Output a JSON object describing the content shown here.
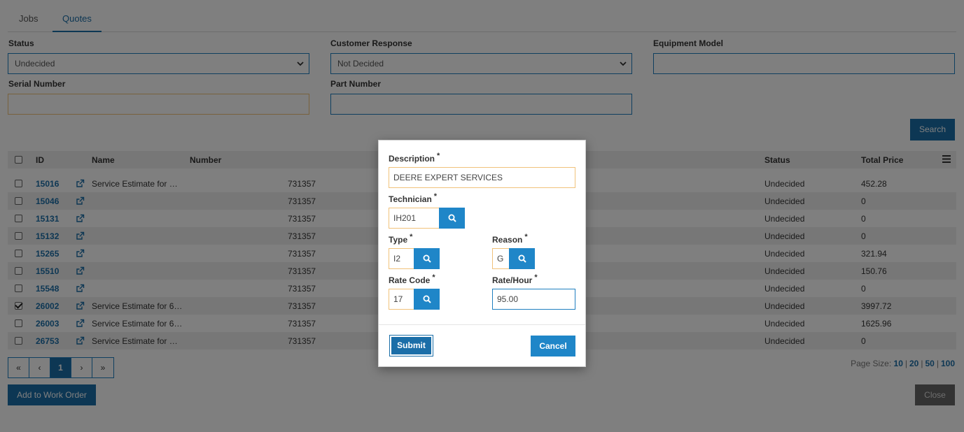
{
  "tabs": [
    {
      "label": "Jobs"
    },
    {
      "label": "Quotes"
    }
  ],
  "filters": {
    "status": {
      "label": "Status",
      "value": "Undecided"
    },
    "customer_response": {
      "label": "Customer Response",
      "value": "Not Decided"
    },
    "equipment_model": {
      "label": "Equipment Model",
      "value": ""
    },
    "serial_number": {
      "label": "Serial Number",
      "value": ""
    },
    "part_number": {
      "label": "Part Number",
      "value": ""
    },
    "search_label": "Search"
  },
  "table": {
    "headers": {
      "id": "ID",
      "name": "Name",
      "number": "Number",
      "status": "Status",
      "total_price": "Total Price"
    },
    "rows": [
      {
        "id": "15016",
        "name": "Service Estimate for …",
        "number": "731357",
        "status": "Undecided",
        "total": "452.28",
        "checked": false
      },
      {
        "id": "15046",
        "name": "",
        "number": "731357",
        "status": "Undecided",
        "total": "0",
        "checked": false
      },
      {
        "id": "15131",
        "name": "",
        "number": "731357",
        "status": "Undecided",
        "total": "0",
        "checked": false
      },
      {
        "id": "15132",
        "name": "",
        "number": "731357",
        "status": "Undecided",
        "total": "0",
        "checked": false
      },
      {
        "id": "15265",
        "name": "",
        "number": "731357",
        "status": "Undecided",
        "total": "321.94",
        "checked": false
      },
      {
        "id": "15510",
        "name": "",
        "number": "731357",
        "status": "Undecided",
        "total": "150.76",
        "checked": false
      },
      {
        "id": "15548",
        "name": "",
        "number": "731357",
        "status": "Undecided",
        "total": "0",
        "checked": false
      },
      {
        "id": "26002",
        "name": "Service Estimate for 6…",
        "number": "731357",
        "status": "Undecided",
        "total": "3997.72",
        "checked": true
      },
      {
        "id": "26003",
        "name": "Service Estimate for 6…",
        "number": "731357",
        "status": "Undecided",
        "total": "1625.96",
        "checked": false
      },
      {
        "id": "26753",
        "name": "Service Estimate for …",
        "number": "731357",
        "status": "Undecided",
        "total": "0",
        "checked": false
      }
    ]
  },
  "pager": {
    "first": "«",
    "prev": "‹",
    "current": "1",
    "next": "›",
    "last": "»"
  },
  "page_size": {
    "label": "Page Size:",
    "options": [
      "10",
      "20",
      "50",
      "100"
    ],
    "selected": "10"
  },
  "actions": {
    "add_to_work_order": "Add to Work Order",
    "close": "Close"
  },
  "modal": {
    "description": {
      "label": "Description",
      "value": "DEERE EXPERT SERVICES"
    },
    "technician": {
      "label": "Technician",
      "value": "IH201"
    },
    "type": {
      "label": "Type",
      "value": "I2"
    },
    "reason": {
      "label": "Reason",
      "value": "G"
    },
    "rate_code": {
      "label": "Rate Code",
      "value": "17"
    },
    "rate_hour": {
      "label": "Rate/Hour",
      "value": "95.00"
    },
    "required_mark": "*",
    "submit": "Submit",
    "cancel": "Cancel"
  },
  "colors": {
    "primary": "#1f86c8",
    "primary_dark": "#1b6ea8",
    "input_warning_border": "#f1c27b",
    "close_button": "#666666"
  }
}
